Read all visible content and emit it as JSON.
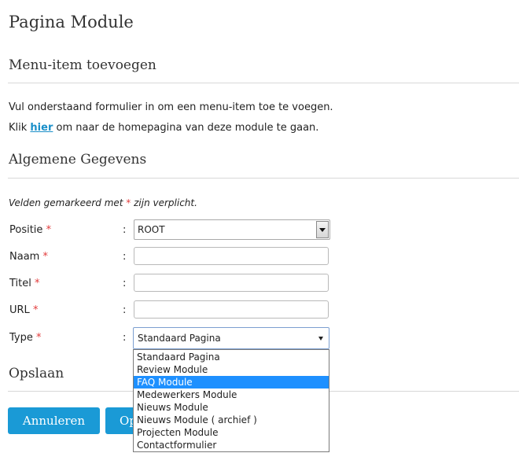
{
  "page": {
    "title": "Pagina Module"
  },
  "section1": {
    "title": "Menu-item toevoegen",
    "intro": "Vul onderstaand formulier in om een menu-item toe te voegen.",
    "link_prefix": "Klik ",
    "link_text": "hier",
    "link_suffix": " om naar de homepagina van deze module te gaan."
  },
  "section2": {
    "title": "Algemene Gegevens",
    "required_note_prefix": "Velden gemarkeerd met ",
    "required_star": "*",
    "required_note_suffix": " zijn verplicht."
  },
  "form": {
    "colon": ":",
    "required_marker": "*",
    "positie": {
      "label": "Positie",
      "value": "ROOT"
    },
    "naam": {
      "label": "Naam",
      "value": ""
    },
    "titel": {
      "label": "Titel",
      "value": ""
    },
    "url": {
      "label": "URL",
      "value": ""
    },
    "type": {
      "label": "Type",
      "value": "Standaard Pagina",
      "options": [
        "Standaard Pagina",
        "Review Module",
        "FAQ Module",
        "Medewerkers Module",
        "Nieuws Module",
        "Nieuws Module ( archief )",
        "Projecten Module",
        "Contactformulier"
      ],
      "highlighted_index": 2
    }
  },
  "section3": {
    "title": "Opslaan"
  },
  "buttons": {
    "cancel": "Annuleren",
    "save": "Opslaan"
  },
  "colors": {
    "accent": "#1a9ad6",
    "link": "#1a8fc9",
    "required": "#e23b3b",
    "highlight": "#1e90ff"
  }
}
